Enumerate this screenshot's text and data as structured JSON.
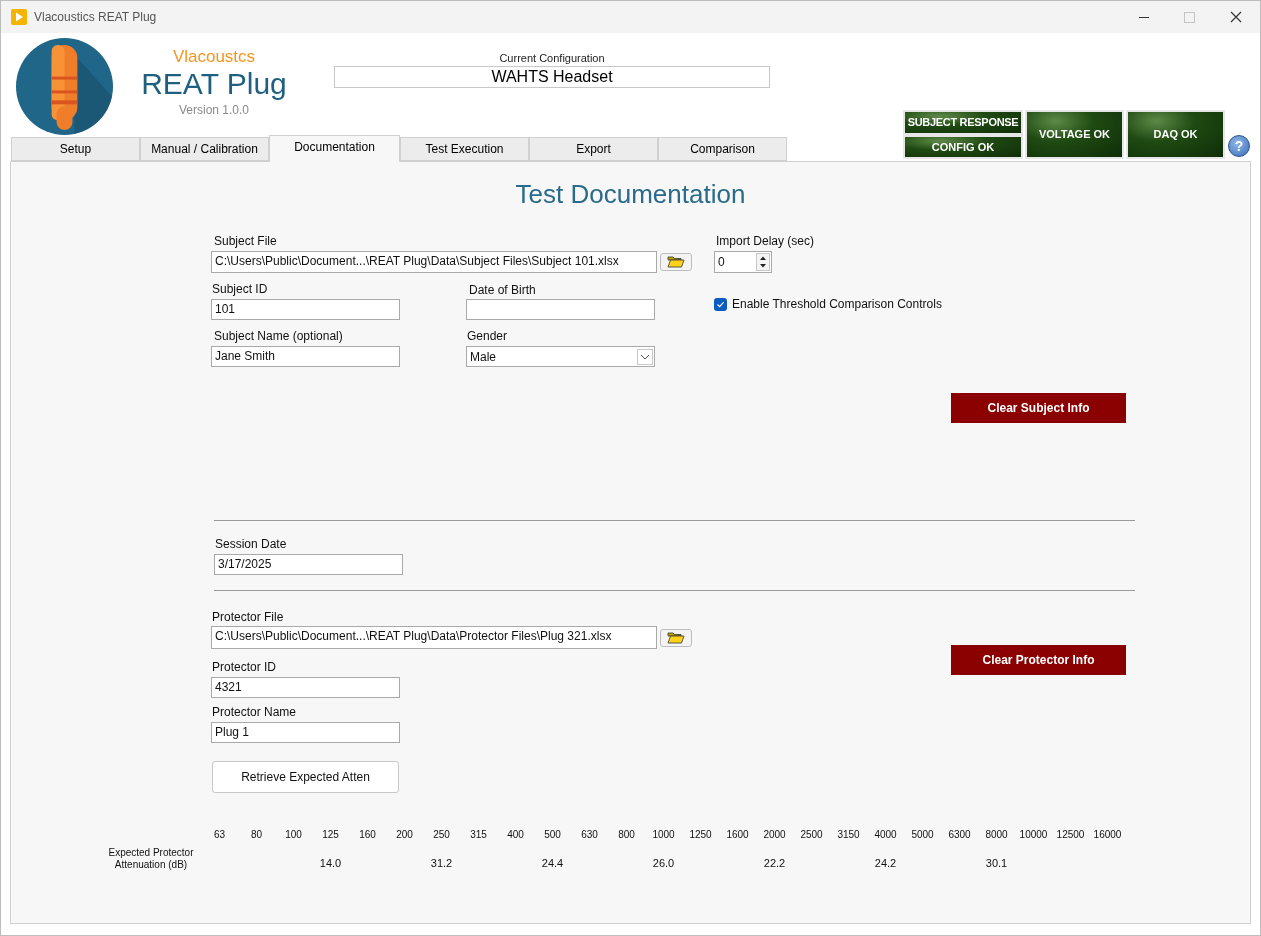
{
  "window": {
    "title": "Vlacoustics REAT Plug"
  },
  "app": {
    "brand": "Vlacoustcs",
    "name": "REAT Plug",
    "version": "Version 1.0.0"
  },
  "configuration": {
    "label": "Current Configuration",
    "value": "WAHTS Headset"
  },
  "tabs": [
    {
      "label": "Setup",
      "selected": false
    },
    {
      "label": "Manual / Calibration",
      "selected": false
    },
    {
      "label": "Documentation",
      "selected": true
    },
    {
      "label": "Test Execution",
      "selected": false
    },
    {
      "label": "Export",
      "selected": false
    },
    {
      "label": "Comparison",
      "selected": false
    }
  ],
  "indicators": [
    {
      "label": "SUBJECT RESPONSE",
      "on": true
    },
    {
      "label": "CONFIG OK",
      "on": true
    },
    {
      "label": "VOLTAGE OK",
      "on": true
    },
    {
      "label": "DAQ OK",
      "on": true
    }
  ],
  "help_button": {
    "label": "?"
  },
  "page_title": "Test Documentation",
  "subject": {
    "file": {
      "label": "Subject File",
      "value": "C:\\Users\\Public\\Document...\\REAT Plug\\Data\\Subject Files\\Subject 101.xlsx"
    },
    "id": {
      "label": "Subject ID",
      "value": "101"
    },
    "date_of_birth": {
      "label": "Date of Birth"
    },
    "name": {
      "label": "Subject Name (optional)",
      "value": "Jane Smith"
    },
    "gender": {
      "label": "Gender",
      "value": "Male"
    },
    "clear_button": "Clear Subject Info"
  },
  "import_delay": {
    "label": "Import Delay (sec)",
    "value": "0"
  },
  "threshold_comparison": {
    "label": "Enable Threshold Comparison Controls",
    "checked": true
  },
  "session_date": {
    "label": "Session Date",
    "value": "3/17/2025"
  },
  "protector": {
    "file": {
      "label": "Protector File",
      "value": "C:\\Users\\Public\\Document...\\REAT Plug\\Data\\Protector Files\\Plug 321.xlsx"
    },
    "id": {
      "label": "Protector ID",
      "value": "4321"
    },
    "name": {
      "label": "Protector Name",
      "value": "Plug 1"
    },
    "clear_button": "Clear Protector Info",
    "retrieve_button": "Retrieve Expected Atten"
  },
  "attenuation": {
    "label": "Expected Protector Attenuation (dB)",
    "bands": [
      {
        "frequency": "63"
      },
      {
        "frequency": "80"
      },
      {
        "frequency": "100"
      },
      {
        "frequency": "125",
        "value": "14.0"
      },
      {
        "frequency": "160"
      },
      {
        "frequency": "200"
      },
      {
        "frequency": "250",
        "value": "31.2"
      },
      {
        "frequency": "315"
      },
      {
        "frequency": "400"
      },
      {
        "frequency": "500",
        "value": "24.4"
      },
      {
        "frequency": "630"
      },
      {
        "frequency": "800"
      },
      {
        "frequency": "1000",
        "value": "26.0"
      },
      {
        "frequency": "1250"
      },
      {
        "frequency": "1600"
      },
      {
        "frequency": "2000",
        "value": "22.2"
      },
      {
        "frequency": "2500"
      },
      {
        "frequency": "3150"
      },
      {
        "frequency": "4000",
        "value": "24.2"
      },
      {
        "frequency": "5000"
      },
      {
        "frequency": "6300"
      },
      {
        "frequency": "8000",
        "value": "30.1"
      },
      {
        "frequency": "10000"
      },
      {
        "frequency": "12500"
      },
      {
        "frequency": "16000"
      }
    ]
  }
}
